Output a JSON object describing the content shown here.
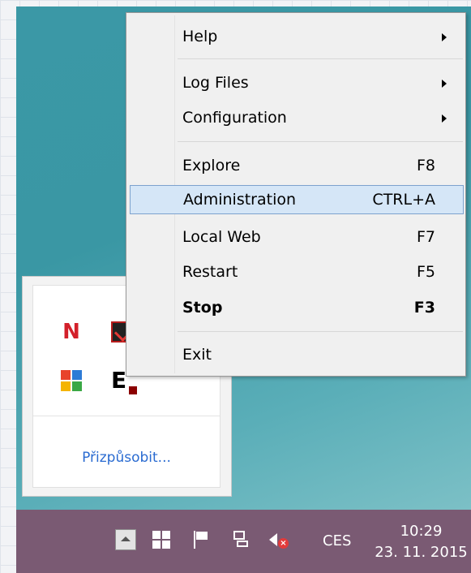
{
  "menu": {
    "items": [
      {
        "label": "Help",
        "shortcut": "",
        "submenu": true,
        "bold": false,
        "highlighted": false
      },
      {
        "label": "Log Files",
        "shortcut": "",
        "submenu": true,
        "bold": false,
        "highlighted": false
      },
      {
        "label": "Configuration",
        "shortcut": "",
        "submenu": true,
        "bold": false,
        "highlighted": false
      },
      {
        "label": "Explore",
        "shortcut": "F8",
        "submenu": false,
        "bold": false,
        "highlighted": false
      },
      {
        "label": "Administration",
        "shortcut": "CTRL+A",
        "submenu": false,
        "bold": false,
        "highlighted": true
      },
      {
        "label": "Local Web",
        "shortcut": "F7",
        "submenu": false,
        "bold": false,
        "highlighted": false
      },
      {
        "label": "Restart",
        "shortcut": "F5",
        "submenu": false,
        "bold": false,
        "highlighted": false
      },
      {
        "label": "Stop",
        "shortcut": "F3",
        "submenu": false,
        "bold": true,
        "highlighted": false
      },
      {
        "label": "Exit",
        "shortcut": "",
        "submenu": false,
        "bold": false,
        "highlighted": false
      }
    ]
  },
  "tray_panel": {
    "customize_label": "Přizpůsobit...",
    "icons": [
      "norton-icon",
      "pdf-reader-icon",
      "avg-antivirus-icon",
      "e-app-icon"
    ],
    "icon_glyphs": {
      "n": "N",
      "e": "E"
    }
  },
  "taskbar": {
    "language": "CES",
    "time": "10:29",
    "date": "23. 11. 2015",
    "icons": [
      "show-hidden-icons-button",
      "windows-icon",
      "action-center-flag-icon",
      "network-icon",
      "volume-muted-icon"
    ]
  },
  "colors": {
    "desktop": "#3b98a6",
    "taskbar": "#7a5a73",
    "menu_highlight": "#d5e6f7",
    "link": "#2a6bd1"
  }
}
